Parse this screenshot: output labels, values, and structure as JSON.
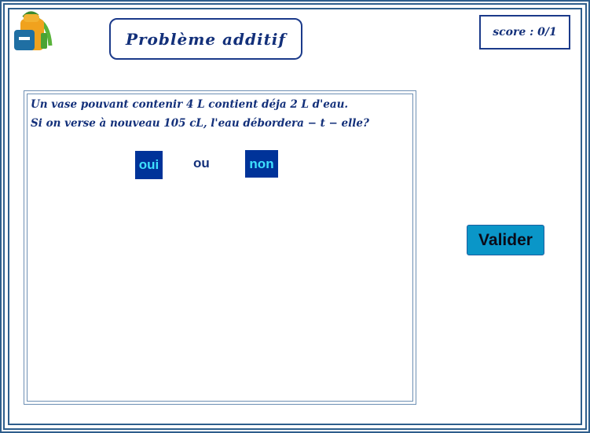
{
  "header": {
    "title": "Problème additif",
    "score": "score : 0/1",
    "logo_icon": "backpack-icon"
  },
  "question": {
    "line1": "Un vase pouvant contenir 4 L contient déja 2 L d'eau.",
    "line2": "Si on verse à nouveau 105 cL, l'eau débordera − t − elle?"
  },
  "choices": {
    "yes_label": "oui",
    "separator": "ou",
    "no_label": "non"
  },
  "actions": {
    "submit_label": "Valider"
  },
  "colors": {
    "frame": "#2e5e8c",
    "text": "#13307a",
    "choice_bg": "#003399",
    "choice_text": "#3fe0ff",
    "submit_bg": "#0a96c8"
  }
}
